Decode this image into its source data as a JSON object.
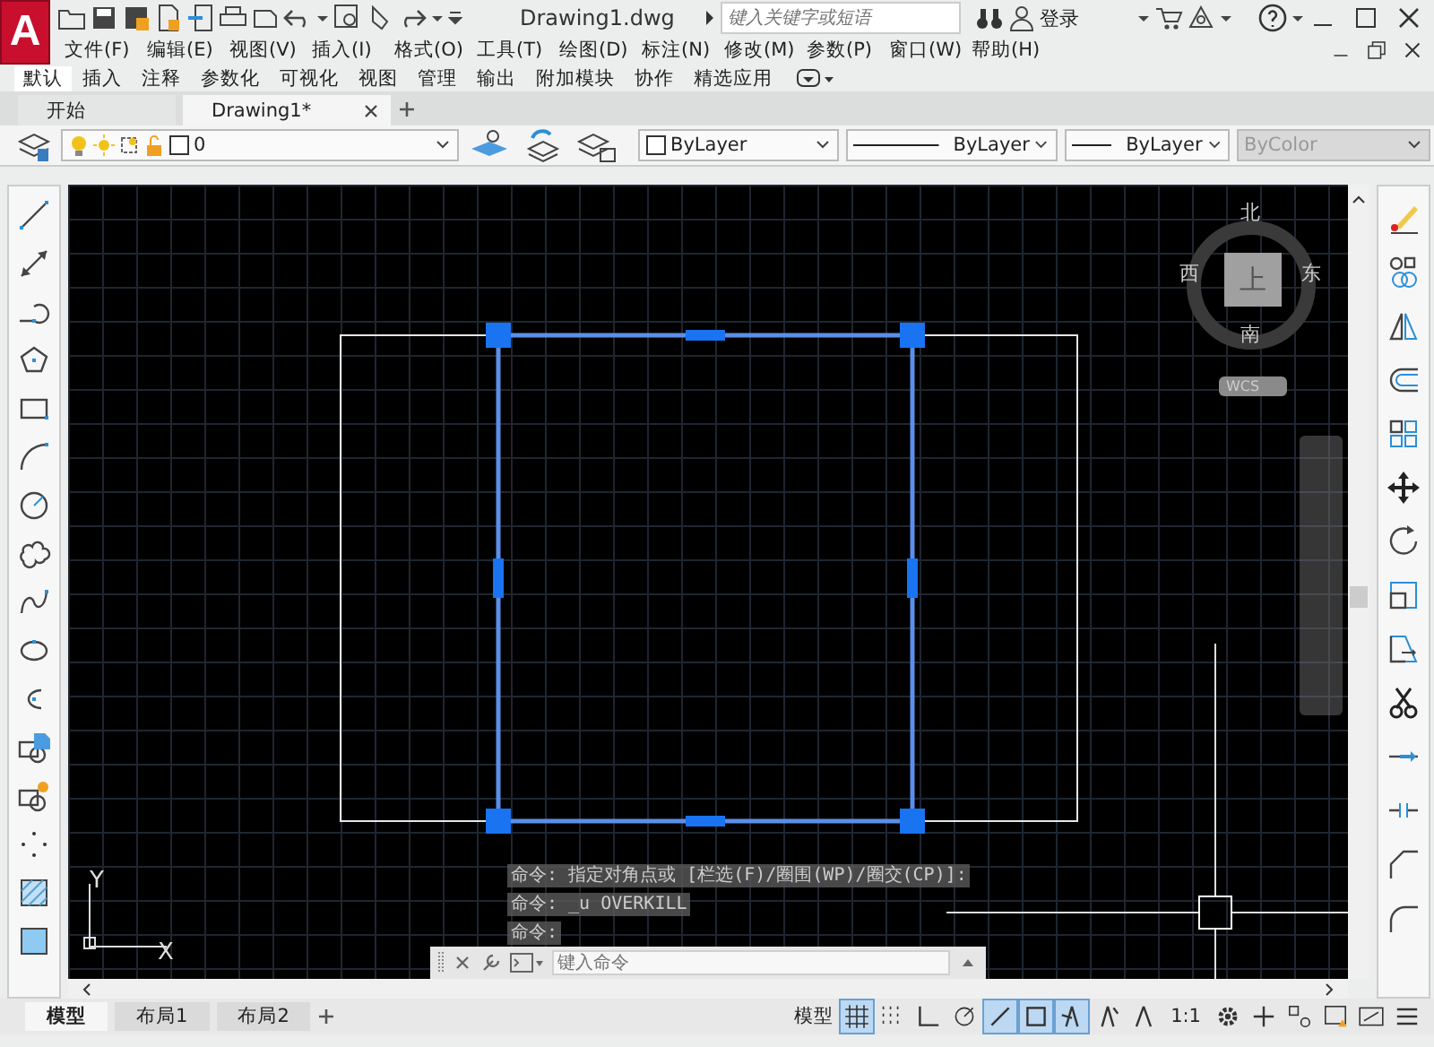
{
  "app_button": {
    "label": "A"
  },
  "title": "Drawing1.dwg",
  "search": {
    "placeholder": "键入关键字或短语"
  },
  "login": "登录",
  "menu": [
    "文件(F)",
    "编辑(E)",
    "视图(V)",
    "插入(I)",
    "格式(O)",
    "工具(T)",
    "绘图(D)",
    "标注(N)",
    "修改(M)",
    "参数(P)",
    "窗口(W)",
    "帮助(H)"
  ],
  "ribbon_tabs": [
    {
      "label": "默认",
      "selected": true
    },
    {
      "label": "插入",
      "selected": false
    },
    {
      "label": "注释",
      "selected": false
    },
    {
      "label": "参数化",
      "selected": false
    },
    {
      "label": "可视化",
      "selected": false
    },
    {
      "label": "视图",
      "selected": false
    },
    {
      "label": "管理",
      "selected": false
    },
    {
      "label": "输出",
      "selected": false
    },
    {
      "label": "附加模块",
      "selected": false
    },
    {
      "label": "协作",
      "selected": false
    },
    {
      "label": "精选应用",
      "selected": false
    }
  ],
  "doc_tabs": [
    {
      "label": "开始",
      "selected": false,
      "closable": false
    },
    {
      "label": "Drawing1*",
      "selected": true,
      "closable": true
    }
  ],
  "layer": {
    "value": "0"
  },
  "properties": [
    {
      "kind": "color",
      "value": "ByLayer",
      "disabled": false
    },
    {
      "kind": "linetype",
      "value": "ByLayer",
      "disabled": false
    },
    {
      "kind": "lineweight",
      "value": "ByLayer",
      "disabled": false
    },
    {
      "kind": "plot",
      "value": "ByColor",
      "disabled": true
    }
  ],
  "viewcube": {
    "north": "北",
    "south": "南",
    "west": "西",
    "east": "东",
    "face": "上",
    "ucs": "WCS"
  },
  "ucs_icon": {
    "x": "X",
    "y": "Y"
  },
  "shapes": [
    {
      "kind": "rect",
      "selected": false
    },
    {
      "kind": "rect",
      "selected": true
    }
  ],
  "command": {
    "history": [
      "命令: 指定对角点或 [栏选(F)/圈围(WP)/圈交(CP)]:",
      "命令: _u OVERKILL",
      "命令:"
    ],
    "placeholder": "键入命令"
  },
  "layout_tabs": [
    {
      "label": "模型",
      "selected": true
    },
    {
      "label": "布局1",
      "selected": false
    },
    {
      "label": "布局2",
      "selected": false
    }
  ],
  "status": {
    "model": "模型",
    "scale": "1:1"
  },
  "status_toggles": [
    {
      "kind": "grid",
      "on": true
    },
    {
      "kind": "snap",
      "on": false
    },
    {
      "kind": "ortho",
      "on": false
    },
    {
      "kind": "polar",
      "on": false
    },
    {
      "kind": "isodraft",
      "on": true
    },
    {
      "kind": "osnap",
      "on": true
    },
    {
      "kind": "annotation",
      "on": true
    },
    {
      "kind": "autoscale",
      "on": false
    },
    {
      "kind": "annoscale",
      "on": false
    }
  ]
}
